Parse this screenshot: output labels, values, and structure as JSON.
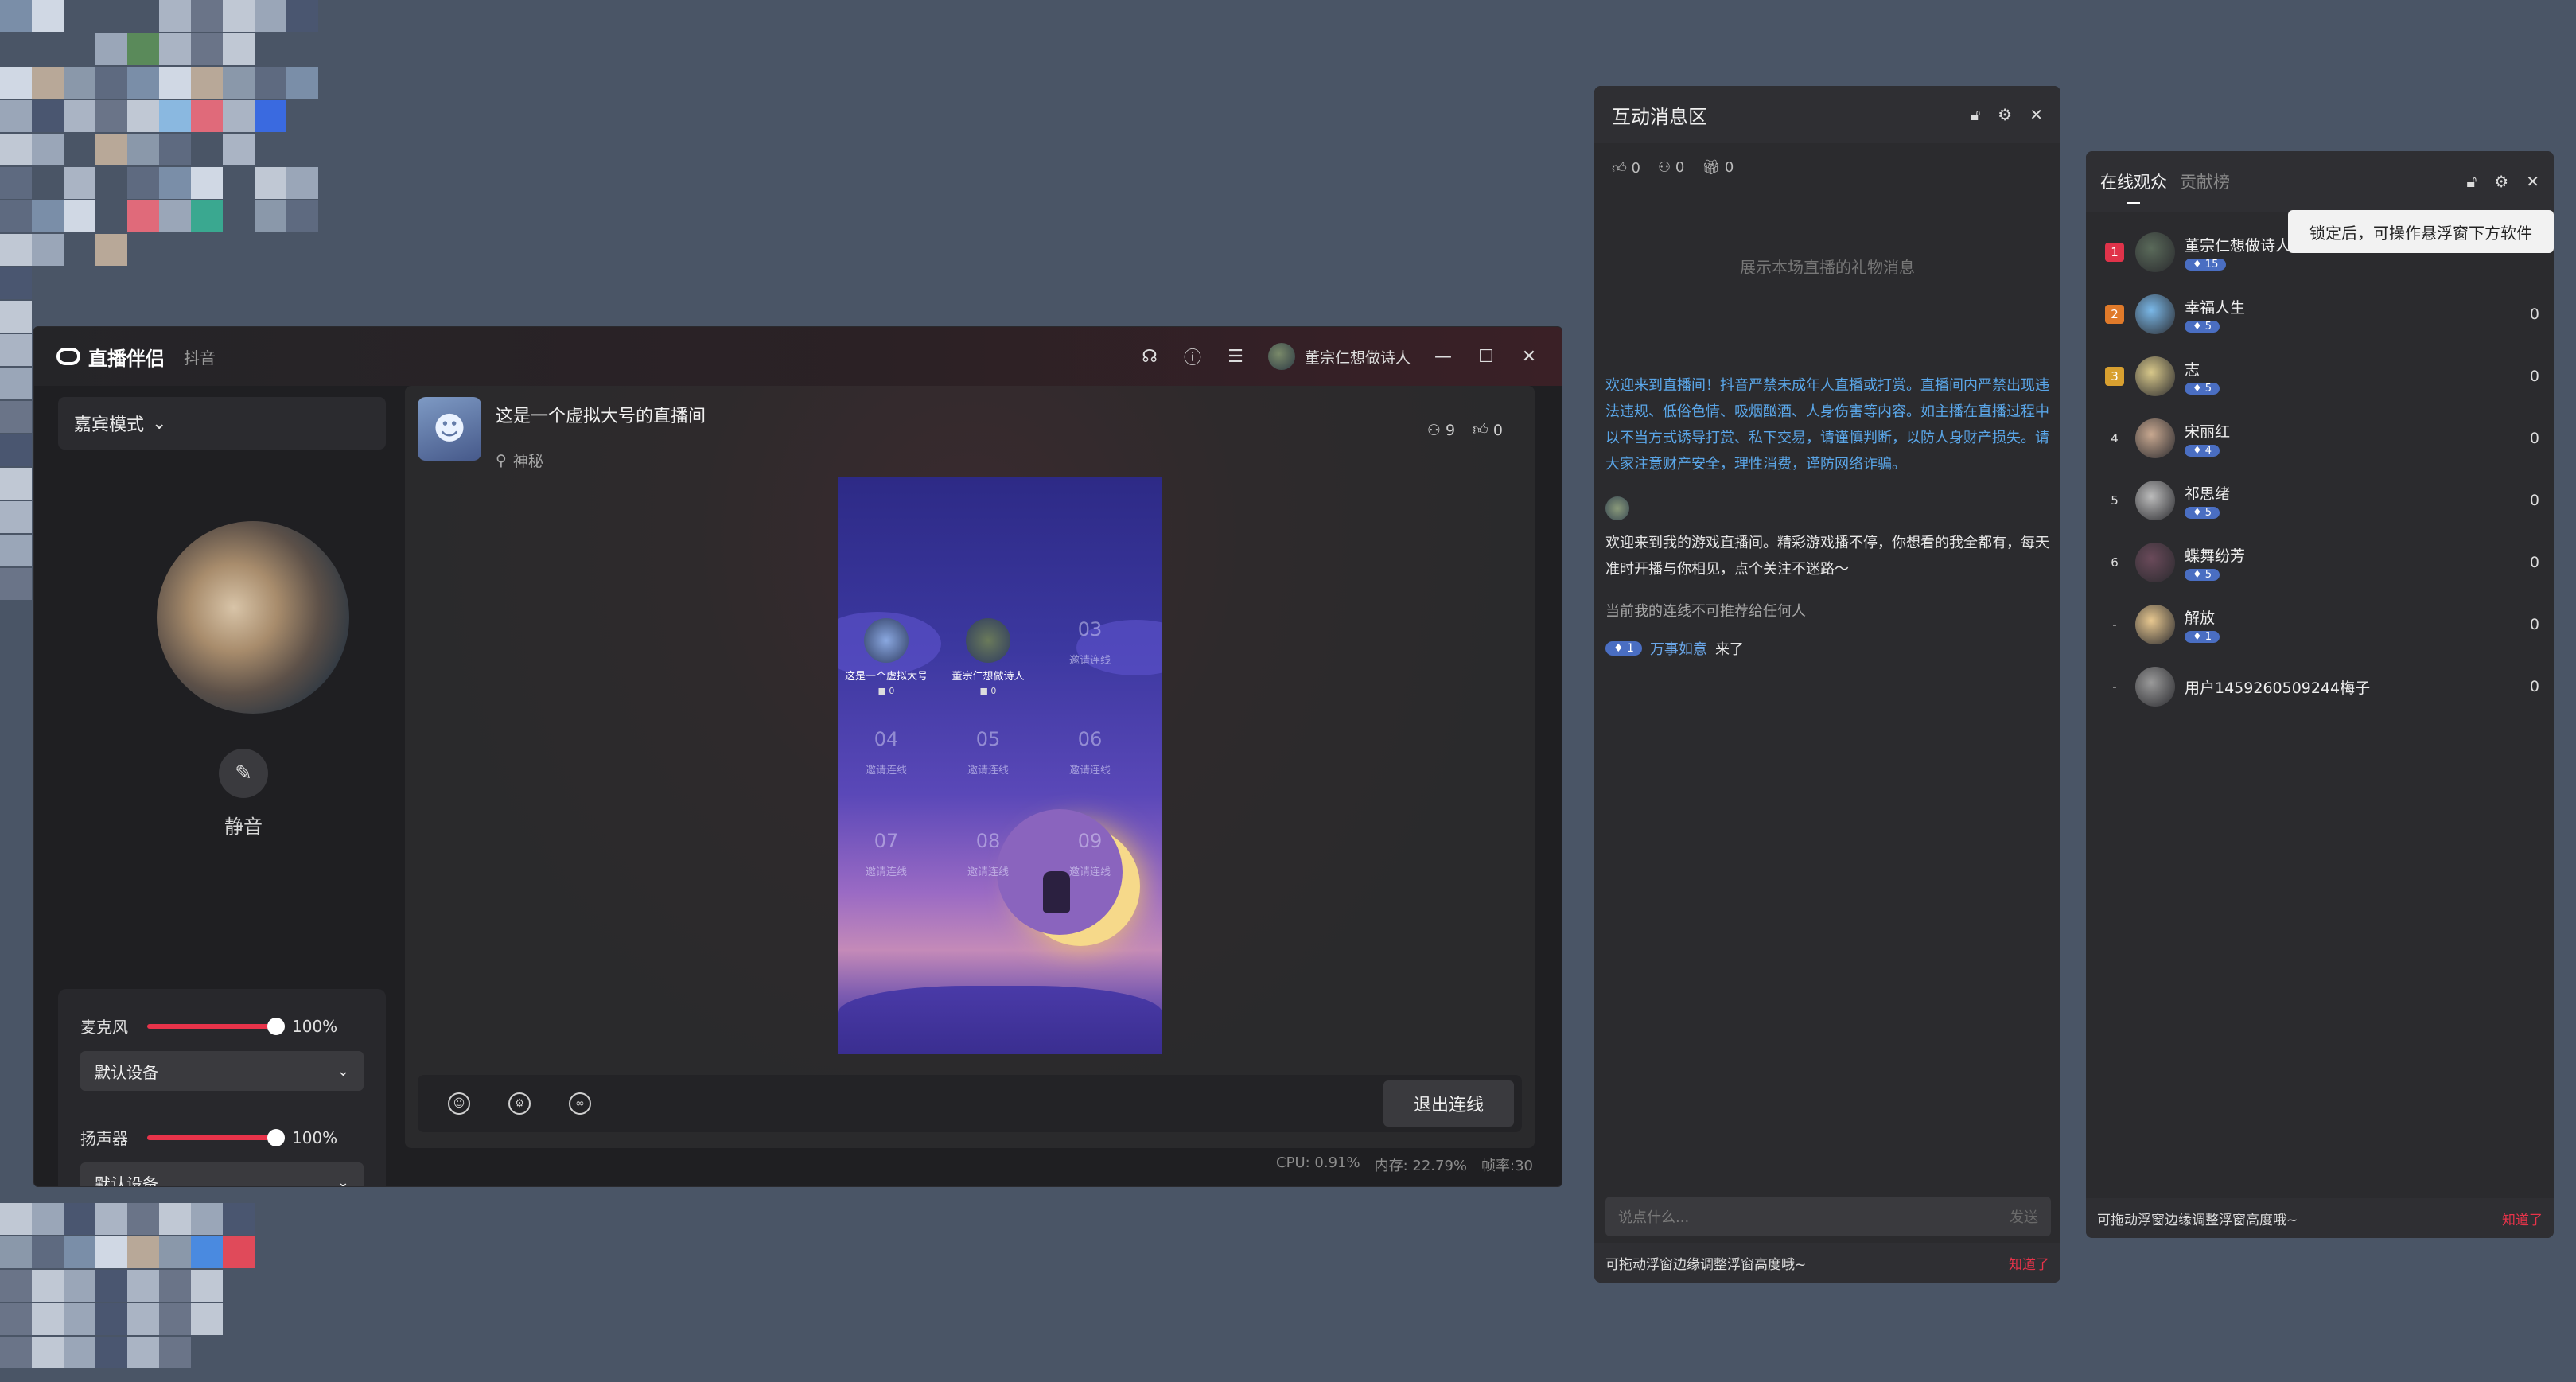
{
  "colors": {
    "accent": "#e8334a",
    "link": "#5aa6e8",
    "badge": "#4a6ec2"
  },
  "main": {
    "app_name": "直播伴侣",
    "app_sub": "抖音",
    "user_name": "董宗仁想做诗人",
    "icons": [
      "headset-icon",
      "help-icon",
      "menu-icon",
      "minimize-icon",
      "maximize-icon",
      "close-icon"
    ],
    "mode_label": "嘉宾模式",
    "mute_label": "静音",
    "mic": {
      "label": "麦克风",
      "level": 100,
      "level_text": "100%",
      "device": "默认设备"
    },
    "speaker": {
      "label": "扬声器",
      "level": 100,
      "level_text": "100%",
      "device": "默认设备"
    },
    "room": {
      "title": "这是一个虚拟大号的直播间",
      "location": "神秘",
      "viewers": "9",
      "likes": "0"
    },
    "slots": [
      {
        "kind": "user",
        "name": "这是一个虚拟大号",
        "score": "■ 0"
      },
      {
        "kind": "user",
        "name": "董宗仁想做诗人",
        "score": "■ 0"
      },
      {
        "kind": "empty",
        "num": "03",
        "label": "邀请连线"
      },
      {
        "kind": "empty",
        "num": "04",
        "label": "邀请连线"
      },
      {
        "kind": "empty",
        "num": "05",
        "label": "邀请连线"
      },
      {
        "kind": "empty",
        "num": "06",
        "label": "邀请连线"
      },
      {
        "kind": "empty",
        "num": "07",
        "label": "邀请连线"
      },
      {
        "kind": "empty",
        "num": "08",
        "label": "邀请连线"
      },
      {
        "kind": "empty",
        "num": "09",
        "label": "邀请连线"
      }
    ],
    "exit_label": "退出连线",
    "perf": {
      "cpu": "CPU: 0.91%",
      "mem": "内存: 22.79%",
      "fps": "帧率:30"
    }
  },
  "messages": {
    "title": "互动消息区",
    "likes": "0",
    "users": "0",
    "gifts": "0",
    "gift_hint": "展示本场直播的礼物消息",
    "notice": "欢迎来到直播间！抖音严禁未成年人直播或打赏。直播间内严禁出现违法违规、低俗色情、吸烟酗酒、人身伤害等内容。如主播在直播过程中以不当方式诱导打赏、私下交易，请谨慎判断，以防人身财产损失。请大家注意财产安全，理性消费，谨防网络诈骗。",
    "welcome": "欢迎来到我的游戏直播间。精彩游戏播不停，你想看的我全都有，每天准时开播与你相见，点个关注不迷路～",
    "plain": "当前我的连线不可推荐给任何人",
    "join_level": "1",
    "join_name": "万事如意",
    "join_suffix": "来了",
    "input_placeholder": "说点什么...",
    "send_label": "发送",
    "footer_tip": "可拖动浮窗边缘调整浮窗高度哦~",
    "footer_ok": "知道了"
  },
  "audience": {
    "tab_online": "在线观众",
    "tab_rank": "贡献榜",
    "tooltip": "锁定后，可操作悬浮窗下方软件",
    "rows": [
      {
        "rank": "1",
        "name": "董宗仁想做诗人",
        "level": "15",
        "score": "",
        "color": "#5a6a5a"
      },
      {
        "rank": "2",
        "name": "幸福人生",
        "level": "5",
        "score": "0",
        "color": "#7ab8e8"
      },
      {
        "rank": "3",
        "name": "志",
        "level": "5",
        "score": "0",
        "color": "#d8c88a"
      },
      {
        "rank": "4",
        "name": "宋丽红",
        "level": "4",
        "score": "0",
        "color": "#c8a890"
      },
      {
        "rank": "5",
        "name": "祁思绪",
        "level": "5",
        "score": "0",
        "color": "#bcbcbc"
      },
      {
        "rank": "6",
        "name": "蝶舞纷芳",
        "level": "5",
        "score": "0",
        "color": "#6a4a5a"
      },
      {
        "rank": "-",
        "name": "解放",
        "level": "1",
        "score": "0",
        "color": "#e8c890"
      },
      {
        "rank": "-",
        "name": "用户1459260509244梅子",
        "level": "",
        "score": "0",
        "color": "#9a9a9a"
      }
    ],
    "footer_tip": "可拖动浮窗边缘调整浮窗高度哦~",
    "footer_ok": "知道了"
  }
}
